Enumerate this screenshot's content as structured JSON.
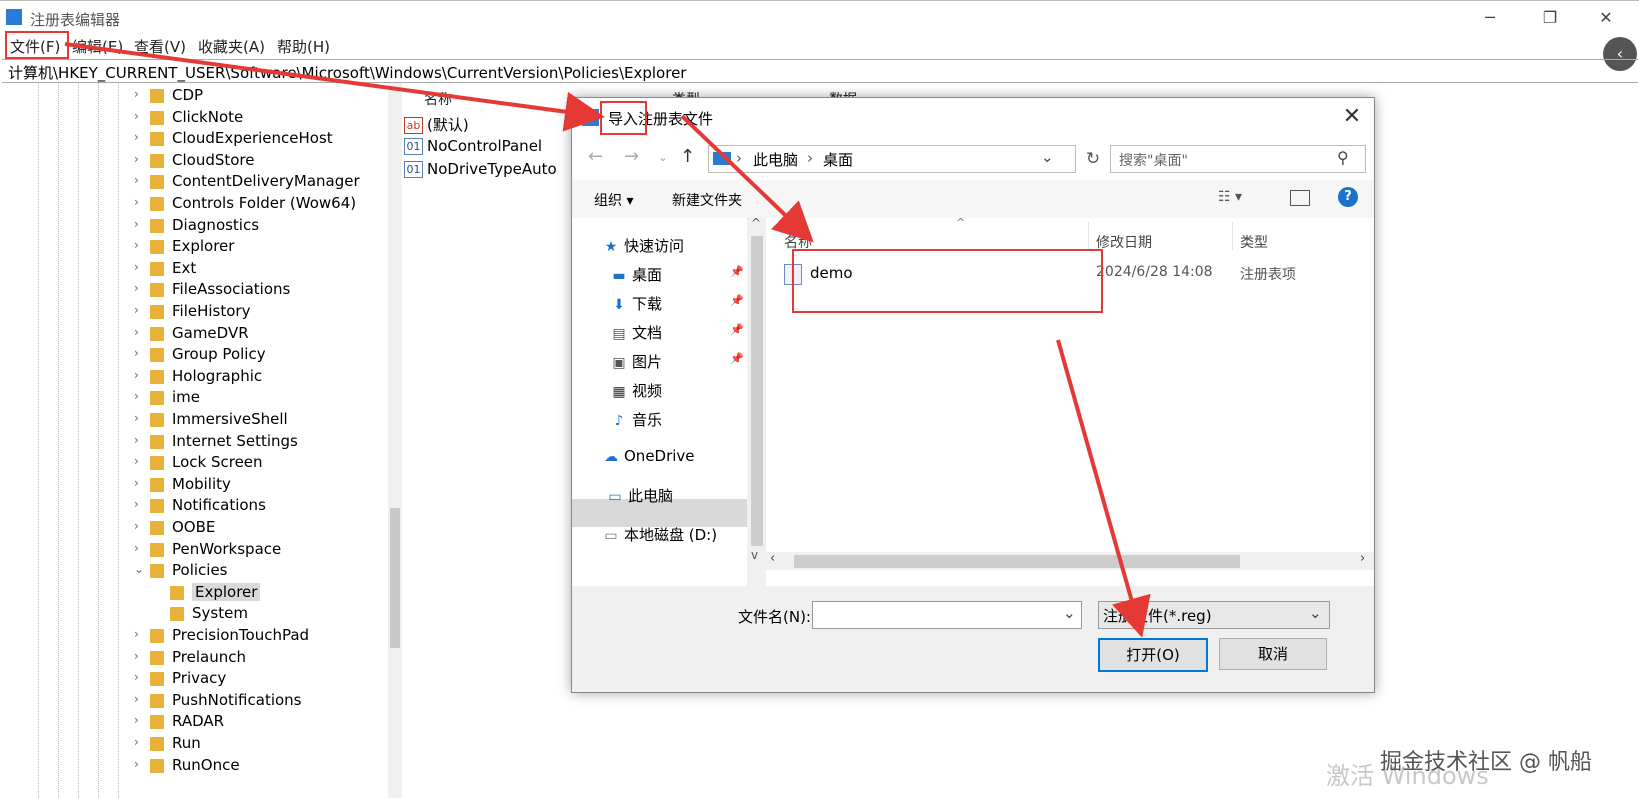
{
  "window": {
    "title": "注册表编辑器",
    "menu": [
      "文件(F)",
      "编辑(E)",
      "查看(V)",
      "收藏夹(A)",
      "帮助(H)"
    ],
    "address": "计算机\\HKEY_CURRENT_USER\\Software\\Microsoft\\Windows\\CurrentVersion\\Policies\\Explorer"
  },
  "tree": {
    "items": [
      "CDP",
      "ClickNote",
      "CloudExperienceHost",
      "CloudStore",
      "ContentDeliveryManager",
      "Controls Folder (Wow64)",
      "Diagnostics",
      "Explorer",
      "Ext",
      "FileAssociations",
      "FileHistory",
      "GameDVR",
      "Group Policy",
      "Holographic",
      "ime",
      "ImmersiveShell",
      "Internet Settings",
      "Lock Screen",
      "Mobility",
      "Notifications",
      "OOBE",
      "PenWorkspace",
      "Policies"
    ],
    "children": [
      "Explorer",
      "System"
    ],
    "after": [
      "PrecisionTouchPad",
      "Prelaunch",
      "Privacy",
      "PushNotifications",
      "RADAR",
      "Run",
      "RunOnce"
    ]
  },
  "values": {
    "headers": [
      "名称",
      "类型",
      "数据"
    ],
    "rows": [
      "(默认)",
      "NoControlPanel",
      "NoDriveTypeAuto"
    ]
  },
  "dialog": {
    "title": "导入注册表文件",
    "path": [
      "此电脑",
      "桌面"
    ],
    "search_placeholder": "搜索\"桌面\"",
    "organize": "组织 ▾",
    "new_folder": "新建文件夹",
    "nav": {
      "quick_access": "快速访问",
      "desktop": "桌面",
      "downloads": "下载",
      "documents": "文档",
      "pictures": "图片",
      "videos": "视频",
      "music": "音乐",
      "onedrive": "OneDrive",
      "this_pc": "此电脑",
      "local_disk": "本地磁盘 (D:)"
    },
    "columns": [
      "名称",
      "修改日期",
      "类型"
    ],
    "files": [
      {
        "name": "demo",
        "date": "2024/6/28 14:08",
        "type": "注册表项"
      }
    ],
    "filename_label": "文件名(N):",
    "filename_value": "",
    "filetype": "注册文件(*.reg)",
    "open": "打开(O)",
    "cancel": "取消"
  },
  "watermark": {
    "activate": "激活 Windows",
    "site": "掘金技术社区 @ 帆船"
  },
  "colors": {
    "annotation": "#e53935",
    "folder": "#e8b13a",
    "accent": "#0078d7"
  }
}
